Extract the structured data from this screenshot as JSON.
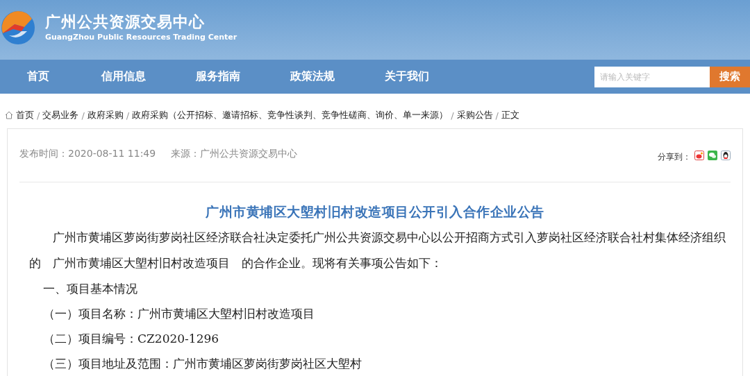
{
  "header": {
    "title": "广州公共资源交易中心",
    "subtitle": "GuangZhou Public Resources Trading Center"
  },
  "nav": [
    "首页",
    "信用信息",
    "服务指南",
    "政策法规",
    "关于我们"
  ],
  "search": {
    "placeholder": "请输入关键字",
    "button": "搜索"
  },
  "breadcrumb": [
    {
      "label": "首页"
    },
    {
      "separator": "/",
      "label": "交易业务"
    },
    {
      "separator": "/",
      "label": "政府采购"
    },
    {
      "separator": "/",
      "label": "政府采购（公开招标、邀请招标、竞争性谈判、竞争性磋商、询价、单一来源）"
    },
    {
      "separator": "/",
      "label": "采购公告"
    },
    {
      "separator": "/",
      "label": "正文"
    }
  ],
  "article": {
    "published": "发布时间：2020-08-11 11:49",
    "source": "来源：广州公共资源交易中心",
    "share_label": "分享到：",
    "title": "广州市黄埔区大塱村旧村改造项目公开引入合作企业公告",
    "intro": "广州市黄埔区萝岗街萝岗社区经济联合社决定委托广州公共资源交易中心以公开招商方式引入萝岗社区经济联合社村集体经济组织的　广州市黄埔区大塱村旧村改造项目　的合作企业。现将有关事项公告如下：",
    "lines": [
      "一、项目基本情况",
      "（一）项目名称：广州市黄埔区大塱村旧村改造项目",
      "（二）项目编号：CZ2020-1296",
      "（三）项目地址及范围：广州市黄埔区萝岗街萝岗社区大塱村"
    ]
  }
}
